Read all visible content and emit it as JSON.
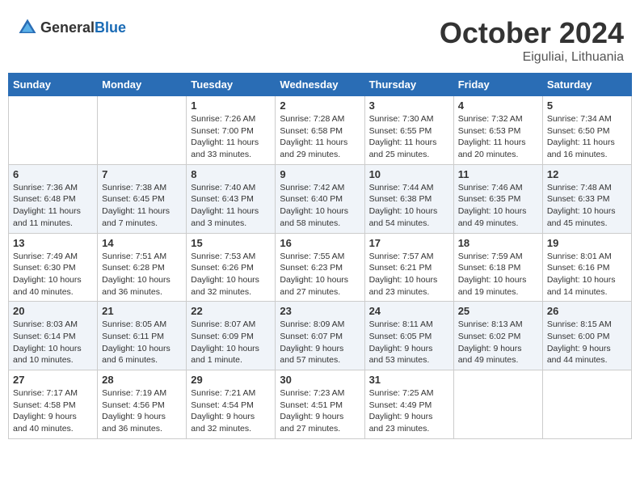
{
  "header": {
    "logo_general": "General",
    "logo_blue": "Blue",
    "month": "October 2024",
    "location": "Eiguliai, Lithuania"
  },
  "weekdays": [
    "Sunday",
    "Monday",
    "Tuesday",
    "Wednesday",
    "Thursday",
    "Friday",
    "Saturday"
  ],
  "weeks": [
    [
      {
        "day": "",
        "content": ""
      },
      {
        "day": "",
        "content": ""
      },
      {
        "day": "1",
        "content": "Sunrise: 7:26 AM\nSunset: 7:00 PM\nDaylight: 11 hours\nand 33 minutes."
      },
      {
        "day": "2",
        "content": "Sunrise: 7:28 AM\nSunset: 6:58 PM\nDaylight: 11 hours\nand 29 minutes."
      },
      {
        "day": "3",
        "content": "Sunrise: 7:30 AM\nSunset: 6:55 PM\nDaylight: 11 hours\nand 25 minutes."
      },
      {
        "day": "4",
        "content": "Sunrise: 7:32 AM\nSunset: 6:53 PM\nDaylight: 11 hours\nand 20 minutes."
      },
      {
        "day": "5",
        "content": "Sunrise: 7:34 AM\nSunset: 6:50 PM\nDaylight: 11 hours\nand 16 minutes."
      }
    ],
    [
      {
        "day": "6",
        "content": "Sunrise: 7:36 AM\nSunset: 6:48 PM\nDaylight: 11 hours\nand 11 minutes."
      },
      {
        "day": "7",
        "content": "Sunrise: 7:38 AM\nSunset: 6:45 PM\nDaylight: 11 hours\nand 7 minutes."
      },
      {
        "day": "8",
        "content": "Sunrise: 7:40 AM\nSunset: 6:43 PM\nDaylight: 11 hours\nand 3 minutes."
      },
      {
        "day": "9",
        "content": "Sunrise: 7:42 AM\nSunset: 6:40 PM\nDaylight: 10 hours\nand 58 minutes."
      },
      {
        "day": "10",
        "content": "Sunrise: 7:44 AM\nSunset: 6:38 PM\nDaylight: 10 hours\nand 54 minutes."
      },
      {
        "day": "11",
        "content": "Sunrise: 7:46 AM\nSunset: 6:35 PM\nDaylight: 10 hours\nand 49 minutes."
      },
      {
        "day": "12",
        "content": "Sunrise: 7:48 AM\nSunset: 6:33 PM\nDaylight: 10 hours\nand 45 minutes."
      }
    ],
    [
      {
        "day": "13",
        "content": "Sunrise: 7:49 AM\nSunset: 6:30 PM\nDaylight: 10 hours\nand 40 minutes."
      },
      {
        "day": "14",
        "content": "Sunrise: 7:51 AM\nSunset: 6:28 PM\nDaylight: 10 hours\nand 36 minutes."
      },
      {
        "day": "15",
        "content": "Sunrise: 7:53 AM\nSunset: 6:26 PM\nDaylight: 10 hours\nand 32 minutes."
      },
      {
        "day": "16",
        "content": "Sunrise: 7:55 AM\nSunset: 6:23 PM\nDaylight: 10 hours\nand 27 minutes."
      },
      {
        "day": "17",
        "content": "Sunrise: 7:57 AM\nSunset: 6:21 PM\nDaylight: 10 hours\nand 23 minutes."
      },
      {
        "day": "18",
        "content": "Sunrise: 7:59 AM\nSunset: 6:18 PM\nDaylight: 10 hours\nand 19 minutes."
      },
      {
        "day": "19",
        "content": "Sunrise: 8:01 AM\nSunset: 6:16 PM\nDaylight: 10 hours\nand 14 minutes."
      }
    ],
    [
      {
        "day": "20",
        "content": "Sunrise: 8:03 AM\nSunset: 6:14 PM\nDaylight: 10 hours\nand 10 minutes."
      },
      {
        "day": "21",
        "content": "Sunrise: 8:05 AM\nSunset: 6:11 PM\nDaylight: 10 hours\nand 6 minutes."
      },
      {
        "day": "22",
        "content": "Sunrise: 8:07 AM\nSunset: 6:09 PM\nDaylight: 10 hours\nand 1 minute."
      },
      {
        "day": "23",
        "content": "Sunrise: 8:09 AM\nSunset: 6:07 PM\nDaylight: 9 hours\nand 57 minutes."
      },
      {
        "day": "24",
        "content": "Sunrise: 8:11 AM\nSunset: 6:05 PM\nDaylight: 9 hours\nand 53 minutes."
      },
      {
        "day": "25",
        "content": "Sunrise: 8:13 AM\nSunset: 6:02 PM\nDaylight: 9 hours\nand 49 minutes."
      },
      {
        "day": "26",
        "content": "Sunrise: 8:15 AM\nSunset: 6:00 PM\nDaylight: 9 hours\nand 44 minutes."
      }
    ],
    [
      {
        "day": "27",
        "content": "Sunrise: 7:17 AM\nSunset: 4:58 PM\nDaylight: 9 hours\nand 40 minutes."
      },
      {
        "day": "28",
        "content": "Sunrise: 7:19 AM\nSunset: 4:56 PM\nDaylight: 9 hours\nand 36 minutes."
      },
      {
        "day": "29",
        "content": "Sunrise: 7:21 AM\nSunset: 4:54 PM\nDaylight: 9 hours\nand 32 minutes."
      },
      {
        "day": "30",
        "content": "Sunrise: 7:23 AM\nSunset: 4:51 PM\nDaylight: 9 hours\nand 27 minutes."
      },
      {
        "day": "31",
        "content": "Sunrise: 7:25 AM\nSunset: 4:49 PM\nDaylight: 9 hours\nand 23 minutes."
      },
      {
        "day": "",
        "content": ""
      },
      {
        "day": "",
        "content": ""
      }
    ]
  ]
}
